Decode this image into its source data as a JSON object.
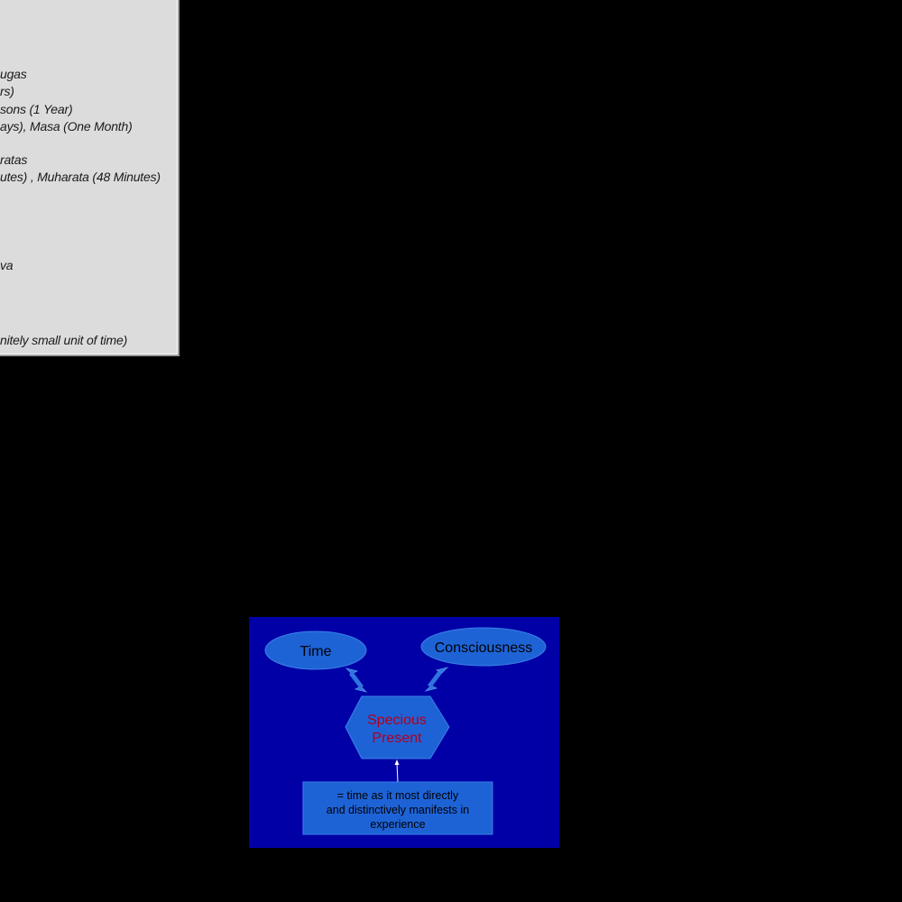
{
  "panel": {
    "lines": [
      "ugas",
      "rs)",
      "sons (1 Year)",
      "ays), Masa (One Month)",
      "ratas",
      "utes) , Muharata (48 Minutes)",
      "va",
      "nitely small unit of time)"
    ]
  },
  "diagram": {
    "time_label": "Time",
    "consciousness_label": "Consciousness",
    "specious_line1": "Specious",
    "specious_line2": "Present",
    "note_line1": "= time as it most directly",
    "note_line2": "and distinctively manifests in",
    "note_line3": "experience",
    "colors": {
      "slide_background": "#0000a6",
      "shape_fill": "#1e63d6",
      "specious_text": "#b0001e",
      "arrow": "#2f74e0"
    }
  }
}
